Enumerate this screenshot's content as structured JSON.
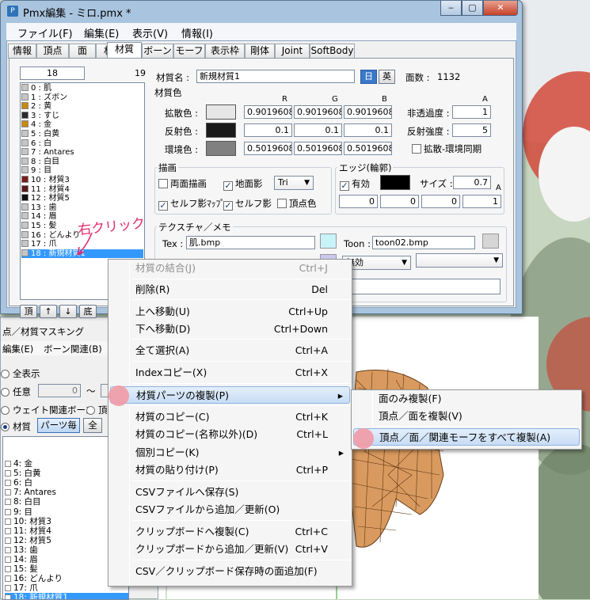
{
  "window": {
    "title": "Pmx編集 - ミロ.pmx *",
    "menu": [
      "ファイル(F)",
      "編集(E)",
      "表示(V)",
      "情報(I)"
    ],
    "tabs": [
      "情報",
      "頂点",
      "面",
      "材質",
      "ボーン",
      "モーフ",
      "表示枠",
      "剛体",
      "Joint",
      "SoftBody"
    ],
    "active_tab": "材質"
  },
  "material_list": {
    "index_value": "18",
    "count": "19",
    "items": [
      {
        "label": "0 : 肌",
        "color": "#c6c6c6"
      },
      {
        "label": "1 : ズボン",
        "color": "#c6c6c6"
      },
      {
        "label": "2 : 黄",
        "color": "#c68a10"
      },
      {
        "label": "3 : すじ",
        "color": "#2b2b2b"
      },
      {
        "label": "4 : 金",
        "color": "#c68a10"
      },
      {
        "label": "5 : 白黄",
        "color": "#c6c6c6"
      },
      {
        "label": "6 : 白",
        "color": "#c6c6c6"
      },
      {
        "label": "7 : Antares",
        "color": "#c6c6c6"
      },
      {
        "label": "8 : 白目",
        "color": "#c6c6c6"
      },
      {
        "label": "9 : 目",
        "color": "#c6c6c6"
      },
      {
        "label": "10 : 材質3",
        "color": "#7a1c1c"
      },
      {
        "label": "11 : 材質4",
        "color": "#5a1818"
      },
      {
        "label": "12 : 材質5",
        "color": "#111111"
      },
      {
        "label": "13 : 歯",
        "color": "#c6c6c6"
      },
      {
        "label": "14 : 眉",
        "color": "#c6c6c6"
      },
      {
        "label": "15 : 髪",
        "color": "#c6c6c6"
      },
      {
        "label": "16 : どんより",
        "color": "#c6c6c6"
      },
      {
        "label": "17 : 爪",
        "color": "#c6c6c6"
      },
      {
        "label": "18 : 新規材質1",
        "color": "#c6c6c6"
      }
    ],
    "nav_buttons": [
      "頂",
      "↑",
      "↓",
      "底"
    ]
  },
  "form": {
    "name_label": "材質名 :",
    "name_value": "新規材質1",
    "lang_jp": "日",
    "lang_en": "英",
    "face_count_label": "面数 :",
    "face_count": "1132",
    "color_section": "材質色",
    "rgba_headers": [
      "R",
      "G",
      "B",
      "A"
    ],
    "diffuse_label": "拡散色 :",
    "diffuse": [
      "0.9019608",
      "0.9019608",
      "0.9019608"
    ],
    "specular_label": "反射色 :",
    "specular": [
      "0.1",
      "0.1",
      "0.1"
    ],
    "ambient_label": "環境色 :",
    "ambient": [
      "0.5019608",
      "0.5019608",
      "0.5019608"
    ],
    "opacity_label": "非透過度 :",
    "opacity": "1",
    "spec_power_label": "反射強度 :",
    "spec_power": "5",
    "sync_label": "拡散-環境同期",
    "swatches": {
      "diffuse": "#e6e6e6",
      "specular": "#1a1a1a",
      "ambient": "#808080"
    },
    "draw_section": "描画",
    "double_sided": "両面描画",
    "ground_shadow": "地面影",
    "tri_value": "Tri",
    "self_shadow_map": "セルフ影ﾏｯﾌﾟ",
    "self_shadow": "セルフ影",
    "vertex_color": "頂点色",
    "edge_section": "エッジ(輪郭)",
    "edge_enabled": "有効",
    "edge_size_label": "サイズ :",
    "edge_size": "0.7",
    "edge_a": "A",
    "edge_rgba": [
      "0",
      "0",
      "0",
      "1"
    ],
    "texture_section": "テクスチャ／メモ",
    "tex_label": "Tex :",
    "tex_value": "肌.bmp",
    "toon_label": "Toon :",
    "toon_value": "toon02.bmp",
    "sphere_value": "無効"
  },
  "lower_window": {
    "title": "点／材質マスキング",
    "menu": [
      "編集(E)",
      "ボーン関連(B)"
    ],
    "show_all": "全表示",
    "arbitrary": "任意",
    "range_from": "0",
    "tilde": "〜",
    "weight_bone": "ウェイト関連ボーン",
    "vertex_short": "頂",
    "material_radio": "材質",
    "parts_button": "パーツ毎",
    "all_button": "全",
    "items": [
      "4: 金",
      "5: 白黄",
      "6: 白",
      "7: Antares",
      "8: 白目",
      "9: 目",
      "10: 材質3",
      "11: 材質4",
      "12: 材質5",
      "13: 歯",
      "14: 眉",
      "15: 髪",
      "16: どんより",
      "17: 爪",
      "18: 新規材質1"
    ]
  },
  "annotation": "右クリック",
  "context_menu": {
    "items": [
      {
        "label": "材質の結合(J)",
        "shortcut": "Ctrl+J",
        "disabled": true
      },
      {
        "label": "削除(R)",
        "shortcut": "Del"
      },
      {
        "label": "上へ移動(U)",
        "shortcut": "Ctrl+Up"
      },
      {
        "label": "下へ移動(D)",
        "shortcut": "Ctrl+Down"
      },
      {
        "label": "全て選択(A)",
        "shortcut": "Ctrl+A"
      },
      {
        "label": "Indexコピー(X)",
        "shortcut": "Ctrl+X"
      },
      {
        "label": "材質パーツの複製(P)",
        "shortcut": "",
        "submenu": true
      },
      {
        "label": "材質のコピー(C)",
        "shortcut": "Ctrl+K"
      },
      {
        "label": "材質のコピー(名称以外)(D)",
        "shortcut": "Ctrl+L"
      },
      {
        "label": "個別コピー(K)",
        "shortcut": "",
        "submenu": true
      },
      {
        "label": "材質の貼り付け(P)",
        "shortcut": "Ctrl+P"
      },
      {
        "label": "CSVファイルへ保存(S)",
        "shortcut": ""
      },
      {
        "label": "CSVファイルから追加／更新(O)",
        "shortcut": ""
      },
      {
        "label": "クリップボードへ複製(C)",
        "shortcut": "Ctrl+C"
      },
      {
        "label": "クリップボードから追加／更新(V)",
        "shortcut": "Ctrl+V"
      },
      {
        "label": "CSV／クリップボード保存時の面追加(F)",
        "shortcut": ""
      }
    ]
  },
  "submenu": {
    "items": [
      {
        "label": "面のみ複製(F)"
      },
      {
        "label": "頂点／面を複製(V)"
      },
      {
        "label": "頂点／面／関連モーフをすべて複製(A)"
      }
    ]
  },
  "colors": {
    "selection": "#3399ff",
    "highlight_marker": "#f19aa5",
    "annotation": "#e3296b"
  }
}
